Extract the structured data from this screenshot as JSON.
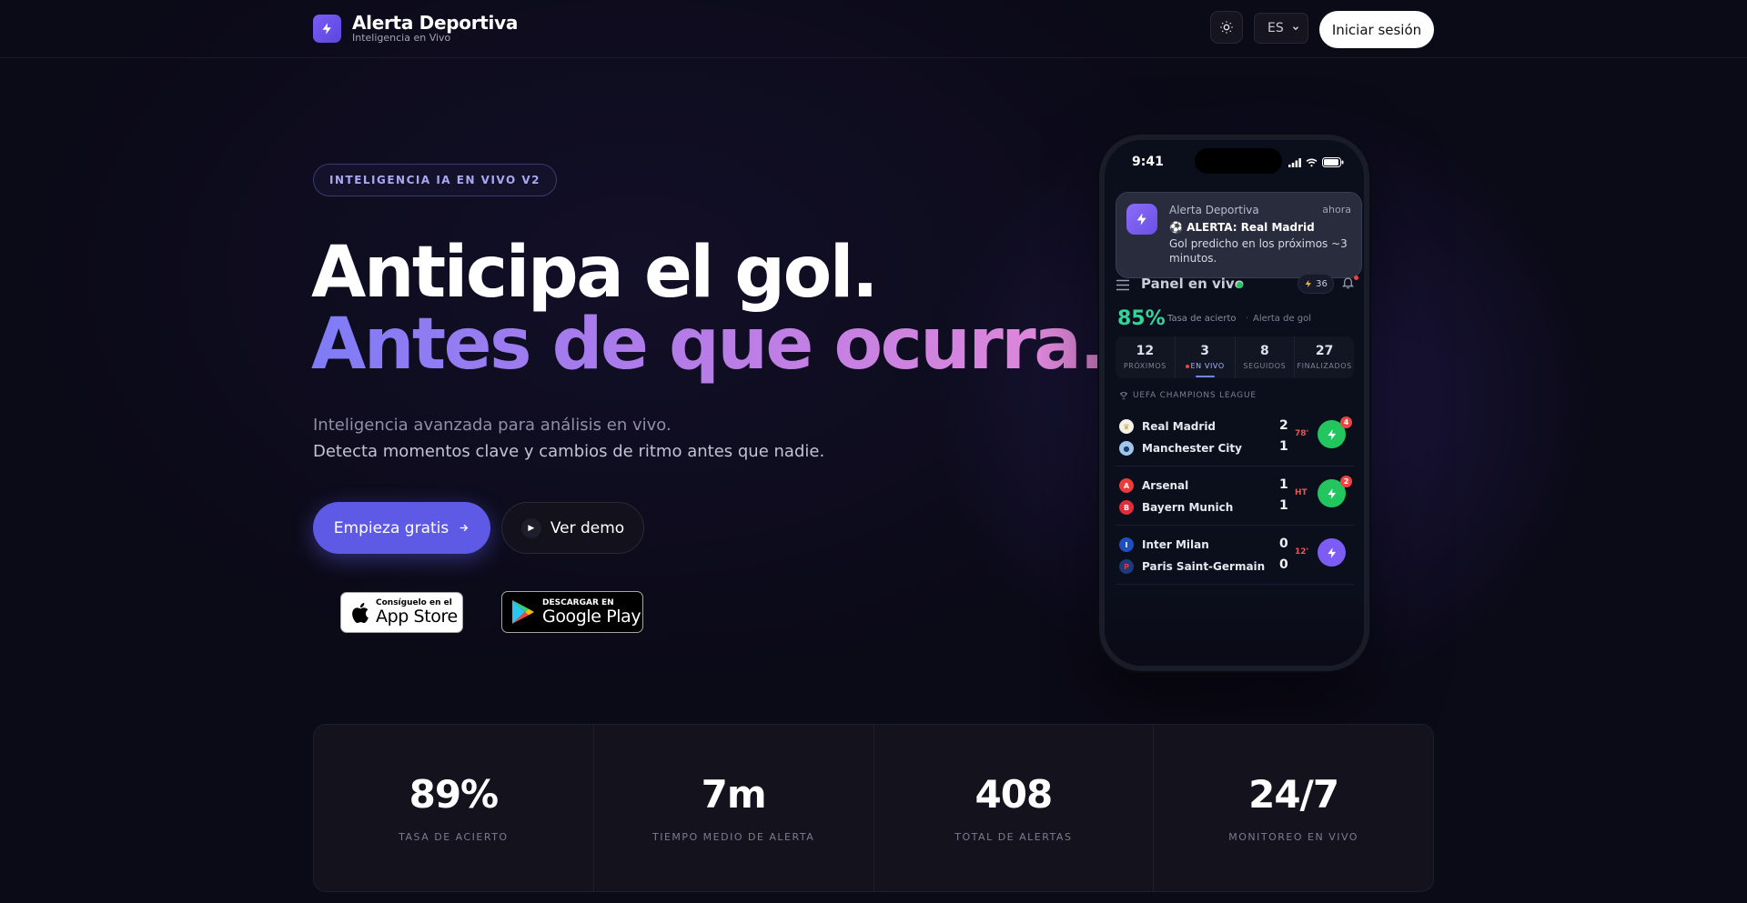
{
  "header": {
    "brand_title": "Alerta Deportiva",
    "brand_subtitle": "Inteligencia en Vivo",
    "language": "ES",
    "login_label": "Iniciar sesión"
  },
  "hero": {
    "badge": "INTELIGENCIA IA EN VIVO V2",
    "headline_1": "Anticipa el gol.",
    "headline_2": "Antes de que ocurra.",
    "subtitle_1": "Inteligencia avanzada para análisis en vivo.",
    "subtitle_2": "Detecta momentos clave y cambios de ritmo antes que nadie.",
    "cta_primary": "Empieza gratis",
    "cta_secondary": "Ver demo",
    "appstore_small": "Consíguelo en el",
    "appstore_big": "App Store",
    "gplay_small": "DESCARGAR EN",
    "gplay_big": "Google Play"
  },
  "phone": {
    "time": "9:41",
    "notification": {
      "app": "Alerta Deportiva",
      "time": "ahora",
      "title": "⚽ ALERTA: Real Madrid",
      "body": "Gol predicho en los próximos ~3 minutos."
    },
    "panel_title": "Panel en vivo",
    "bolt_count": "36",
    "rate_value": "85%",
    "rate_label": "Tasa de acierto",
    "rate_sep": "·",
    "rate_label_2": "Alerta de gol",
    "tabs": [
      {
        "count": "12",
        "label": "PRÓXIMOS"
      },
      {
        "count": "3",
        "label": "EN VIVO"
      },
      {
        "count": "8",
        "label": "SEGUIDOS"
      },
      {
        "count": "27",
        "label": "FINALIZADOS"
      }
    ],
    "league": "UEFA CHAMPIONS LEAGUE",
    "matches": [
      {
        "home": "Real Madrid",
        "away": "Manchester City",
        "home_score": "2",
        "away_score": "1",
        "minute": "78'",
        "alerts": "4"
      },
      {
        "home": "Arsenal",
        "away": "Bayern Munich",
        "home_score": "1",
        "away_score": "1",
        "minute": "HT",
        "alerts": "2"
      },
      {
        "home": "Inter Milan",
        "away": "Paris Saint-Germain",
        "home_score": "0",
        "away_score": "0",
        "minute": "12'",
        "alerts": ""
      }
    ]
  },
  "stats": [
    {
      "value": "89%",
      "label": "TASA DE ACIERTO"
    },
    {
      "value": "7m",
      "label": "TIEMPO MEDIO DE ALERTA"
    },
    {
      "value": "408",
      "label": "TOTAL DE ALERTAS"
    },
    {
      "value": "24/7",
      "label": "MONITOREO EN VIVO"
    }
  ],
  "colors": {
    "accent": "#5e5ae6",
    "live_green": "#22c55e",
    "alert_red": "#ef4444",
    "rate_green": "#34d399"
  }
}
